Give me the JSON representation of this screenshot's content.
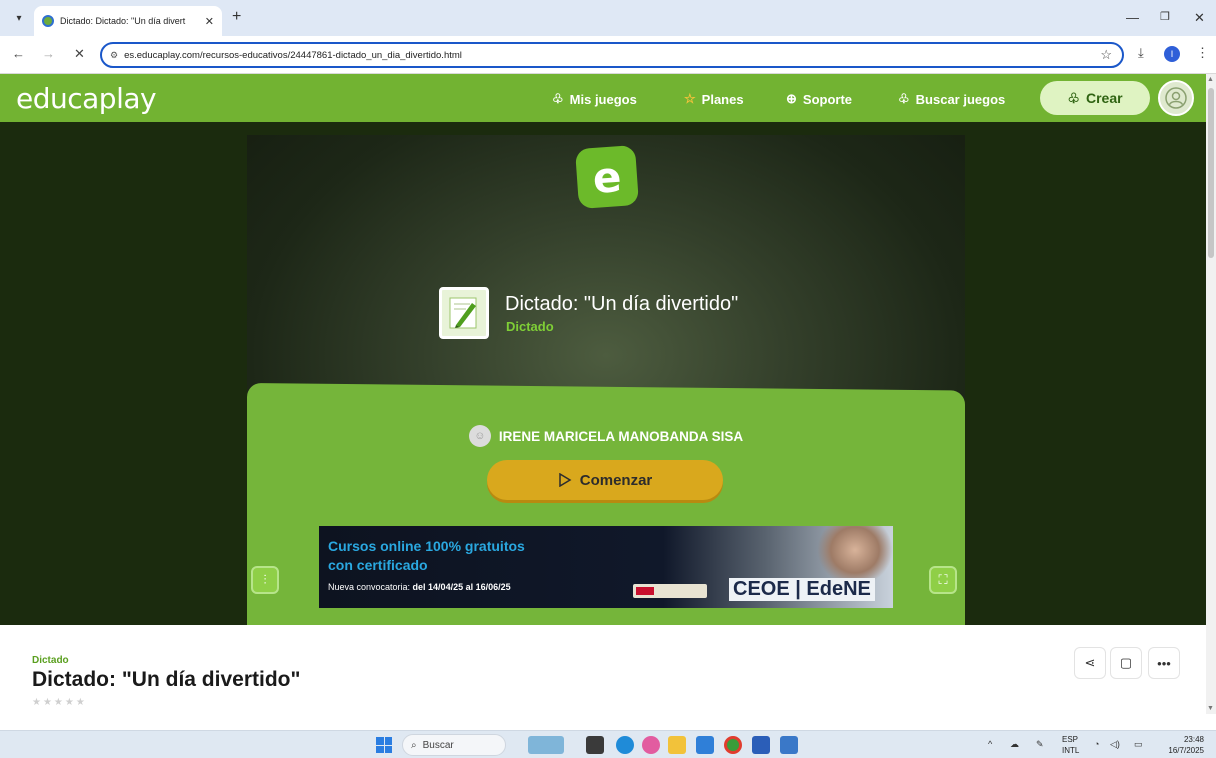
{
  "browser": {
    "tab_title": "Dictado: Dictado: \"Un día divert",
    "url": "es.educaplay.com/recursos-educativos/24447861-dictado_un_dia_divertido.html",
    "profile_initial": "I"
  },
  "header": {
    "logo": "educaplay",
    "nav": [
      {
        "label": "Mis juegos",
        "icon": "puzzle-icon"
      },
      {
        "label": "Planes",
        "icon": "star-icon"
      },
      {
        "label": "Soporte",
        "icon": "lifebuoy-icon"
      },
      {
        "label": "Buscar juegos",
        "icon": "search-puzzle-icon"
      }
    ],
    "create_label": "Crear"
  },
  "activity": {
    "logo_letter": "e",
    "title": "Dictado: \"Un día divertido\"",
    "type": "Dictado",
    "author": "IRENE MARICELA MANOBANDA SISA",
    "start_label": "Comenzar"
  },
  "ad": {
    "line1": "Cursos online 100% gratuitos",
    "line2": "con certificado",
    "line3_prefix": "Nueva convocatoria: ",
    "line3_dates": "del 14/04/25 al 16/06/25",
    "brand": "CEOE | EdeNE"
  },
  "info": {
    "type": "Dictado",
    "title": "Dictado: \"Un día divertido\"",
    "rating_stars": "★★★★★"
  },
  "taskbar": {
    "search_placeholder": "Buscar",
    "lang_line1": "ESP",
    "lang_line2": "INTL",
    "time": "23:48",
    "date": "16/7/2025"
  },
  "colors": {
    "brand_green": "#72b332",
    "stage_dark": "#1b2b0e",
    "start_button": "#d9a81d",
    "accent_blue": "#1a57c9"
  }
}
